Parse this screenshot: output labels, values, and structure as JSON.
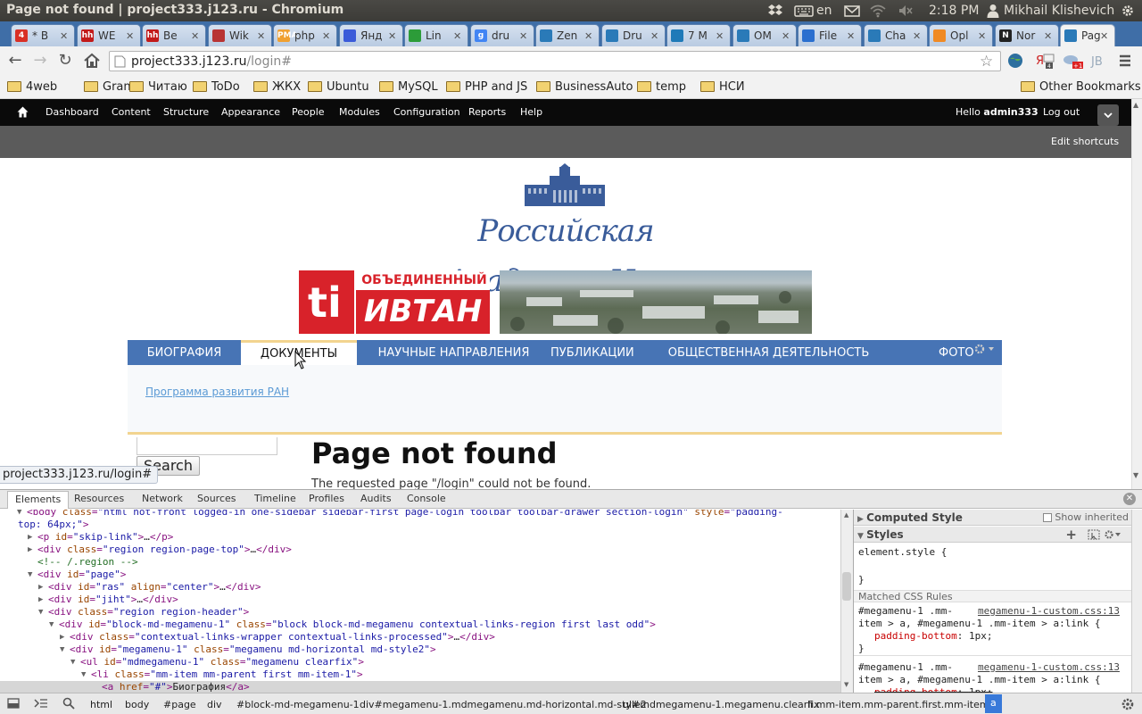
{
  "os": {
    "window_title": "Page not found | project333.j123.ru - Chromium",
    "lang": "en",
    "time": "2:18 PM",
    "user": "Mikhail Klishevich"
  },
  "tabs": [
    {
      "label": "* B",
      "fav": "4",
      "color": "#d93025"
    },
    {
      "label": "WE",
      "fav": "hh",
      "color": "#c21a1a"
    },
    {
      "label": "Ве",
      "fav": "hh",
      "color": "#c21a1a"
    },
    {
      "label": "Wik",
      "fav": "",
      "color": "#b83333"
    },
    {
      "label": "php",
      "fav": "PMA",
      "color": "#f0a030"
    },
    {
      "label": "Янд",
      "fav": "",
      "color": "#3b5bd9"
    },
    {
      "label": "Lin",
      "fav": "",
      "color": "#2c9c39"
    },
    {
      "label": "dru",
      "fav": "g",
      "color": "#4285f4"
    },
    {
      "label": "Zen",
      "fav": "",
      "color": "#2a7ab8"
    },
    {
      "label": "Dru",
      "fav": "",
      "color": "#2a7ab8"
    },
    {
      "label": "7 M",
      "fav": "",
      "color": "#1f7ab8"
    },
    {
      "label": "OM",
      "fav": "",
      "color": "#2a7ab8"
    },
    {
      "label": "File",
      "fav": "",
      "color": "#2b6fcf"
    },
    {
      "label": "Cha",
      "fav": "",
      "color": "#2a7ab8"
    },
    {
      "label": "Opl",
      "fav": "",
      "color": "#f08a24"
    },
    {
      "label": "Nor",
      "fav": "N",
      "color": "#222222"
    },
    {
      "label": "Pag",
      "fav": "",
      "color": "#2a7ab8"
    }
  ],
  "address": {
    "host": "project333.j123.ru",
    "path": "/login#"
  },
  "bookmarks": [
    "4web",
    "Granit",
    "Читаю",
    "ToDo",
    "ЖКХ",
    "Ubuntu",
    "MySQL",
    "PHP and JS",
    "BusinessAuto",
    "temp",
    "НСИ"
  ],
  "other_bookmarks": "Other Bookmarks",
  "admin": {
    "items": [
      "Dashboard",
      "Content",
      "Structure",
      "Appearance",
      "People",
      "Modules",
      "Configuration",
      "Reports",
      "Help"
    ],
    "hello": "Hello",
    "username": "admin333",
    "logout": "Log out",
    "edit_shortcuts": "Edit shortcuts"
  },
  "site": {
    "academy_text": "Российская Академия Наук",
    "logo_top": "ОБЪЕДИНЕННЫЙ",
    "logo_main": "ИВТАН",
    "menu": [
      "БИОГРАФИЯ",
      "ДОКУМЕНТЫ",
      "НАУЧНЫЕ НАПРАВЛЕНИЯ",
      "ПУБЛИКАЦИИ",
      "ОБЩЕСТВЕННАЯ ДЕЯТЕЛЬНОСТЬ",
      "ФОТО"
    ],
    "dropdown_link": "Программа развития РАН",
    "search_button": "Search",
    "page_title": "Page not found",
    "body_text": "The requested page \"/login\" could not be found.",
    "status_url": "project333.j123.ru/login#"
  },
  "devtools": {
    "tabs": [
      "Elements",
      "Resources",
      "Network",
      "Sources",
      "Timeline",
      "Profiles",
      "Audits",
      "Console"
    ],
    "dom_lines": [
      {
        "html": "&lt;body <span class='an'>class</span>=<span class='av'>\"html not-front logged-in one-sidebar sidebar-first page-login toolbar toolbar-drawer section-login\"</span> <span class='an'>style</span>=<span class='av'>\"padding-</span>",
        "indent": 30,
        "arrow": "▼"
      },
      {
        "html": "<span class='av'>top: 64px;\"</span>&gt;",
        "indent": 20,
        "arrow": ""
      },
      {
        "html": "&lt;p <span class='an'>id</span>=<span class='av'>\"skip-link\"</span>&gt;<span class='tx'>…</span>&lt;/p&gt;",
        "indent": 42,
        "arrow": "▶"
      },
      {
        "html": "&lt;div <span class='an'>class</span>=<span class='av'>\"region region-page-top\"</span>&gt;<span class='tx'>…</span>&lt;/div&gt;",
        "indent": 42,
        "arrow": "▶"
      },
      {
        "html": "<span class='cm'>&lt;!-- /.region --&gt;</span>",
        "indent": 42,
        "arrow": ""
      },
      {
        "html": "&lt;div <span class='an'>id</span>=<span class='av'>\"page\"</span>&gt;",
        "indent": 42,
        "arrow": "▼"
      },
      {
        "html": "&lt;div <span class='an'>id</span>=<span class='av'>\"ras\"</span> <span class='an'>align</span>=<span class='av'>\"center\"</span>&gt;<span class='tx'>…</span>&lt;/div&gt;",
        "indent": 54,
        "arrow": "▶"
      },
      {
        "html": "&lt;div <span class='an'>id</span>=<span class='av'>\"jiht\"</span>&gt;<span class='tx'>…</span>&lt;/div&gt;",
        "indent": 54,
        "arrow": "▶"
      },
      {
        "html": "&lt;div <span class='an'>class</span>=<span class='av'>\"region region-header\"</span>&gt;",
        "indent": 54,
        "arrow": "▼"
      },
      {
        "html": "&lt;div <span class='an'>id</span>=<span class='av'>\"block-md-megamenu-1\"</span> <span class='an'>class</span>=<span class='av'>\"block block-md-megamenu contextual-links-region first last odd\"</span>&gt;",
        "indent": 66,
        "arrow": "▼"
      },
      {
        "html": "&lt;div <span class='an'>class</span>=<span class='av'>\"contextual-links-wrapper contextual-links-processed\"</span>&gt;<span class='tx'>…</span>&lt;/div&gt;",
        "indent": 78,
        "arrow": "▶"
      },
      {
        "html": "&lt;div <span class='an'>id</span>=<span class='av'>\"megamenu-1\"</span> <span class='an'>class</span>=<span class='av'>\"megamenu md-horizontal  md-style2\"</span>&gt;",
        "indent": 78,
        "arrow": "▼"
      },
      {
        "html": "&lt;ul <span class='an'>id</span>=<span class='av'>\"mdmegamenu-1\"</span> <span class='an'>class</span>=<span class='av'>\"megamenu clearfix\"</span>&gt;",
        "indent": 90,
        "arrow": "▼"
      },
      {
        "html": "&lt;li <span class='an'>class</span>=<span class='av'>\"mm-item mm-parent first mm-item-1\"</span>&gt;",
        "indent": 102,
        "arrow": "▼"
      },
      {
        "html": "&lt;a <span class='an'>href</span>=<span class='av'>\"#\"</span>&gt;<span class='tx'>Биография</span>&lt;/a&gt;",
        "indent": 114,
        "arrow": ""
      }
    ],
    "styles": {
      "computed": "Computed Style",
      "show_inherited": "Show inherited",
      "styles_header": "Styles",
      "element_style": "element.style {",
      "close_brace": "}",
      "matched": "Matched CSS Rules",
      "rule_source": "megamenu-1-custom.css:13",
      "rule_selector_1": "#megamenu-1 .mm-",
      "rule_selector_2": "item > a, #megamenu-1 .mm-item > a:link {",
      "rule_prop": "padding-bottom",
      "rule_val": "1px;"
    },
    "breadcrumbs": [
      "html",
      "body",
      "#page",
      "div",
      "#block-md-megamenu-1",
      "div#megamenu-1.mdmegamenu.md-horizontal.md-style2",
      "ul#mdmegamenu-1.megamenu.clearfix",
      "li.mm-item.mm-parent.first.mm-item-1",
      "a"
    ]
  }
}
